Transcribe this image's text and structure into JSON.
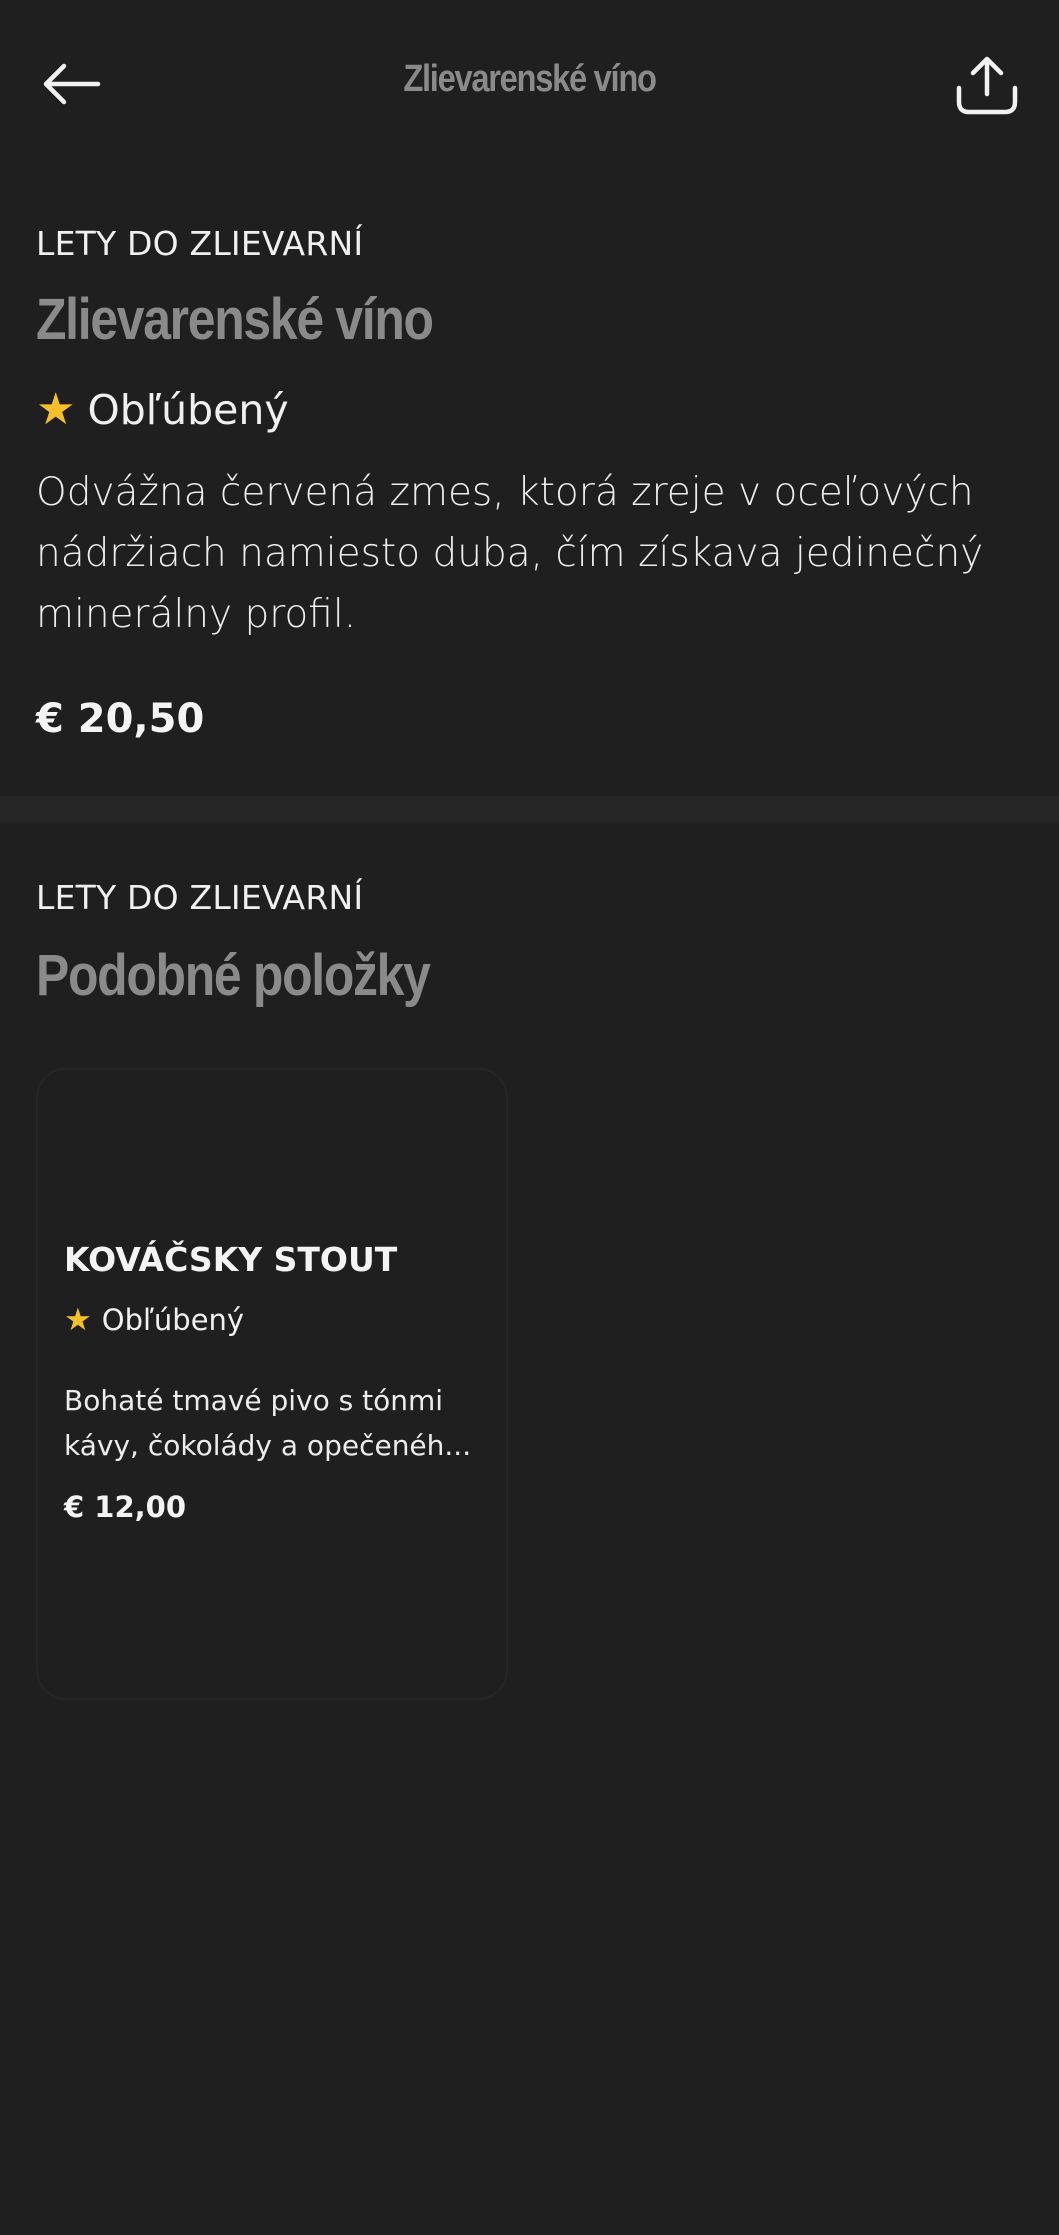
{
  "header": {
    "title": "Zlievarenské víno",
    "back_icon": "arrow-left-icon",
    "share_icon": "share-icon"
  },
  "product": {
    "category": "LETY DO ZLIEVARNÍ",
    "name": "Zlievarenské víno",
    "badge": "Obľúbený",
    "description_lines": [
      "Odvážna červená zmes, ktorá zreje v oceľových",
      "nádržiach namiesto duba, čím získava jedinečný",
      "minerálny profil."
    ],
    "price": "€ 20,50"
  },
  "similar": {
    "category": "LETY DO ZLIEVARNÍ",
    "heading": "Podobné položky",
    "items": [
      {
        "name": "KOVÁČSKY STOUT",
        "badge": "Obľúbený",
        "description_lines": [
          "Bohaté tmavé pivo s tónmi",
          "kávy, čokolády a opečenéh..."
        ],
        "price": "€ 12,00"
      }
    ]
  },
  "colors": {
    "background": "#1f1f1f",
    "accent_star": "#f5c02a",
    "title_gray": "#8a8a8a"
  }
}
